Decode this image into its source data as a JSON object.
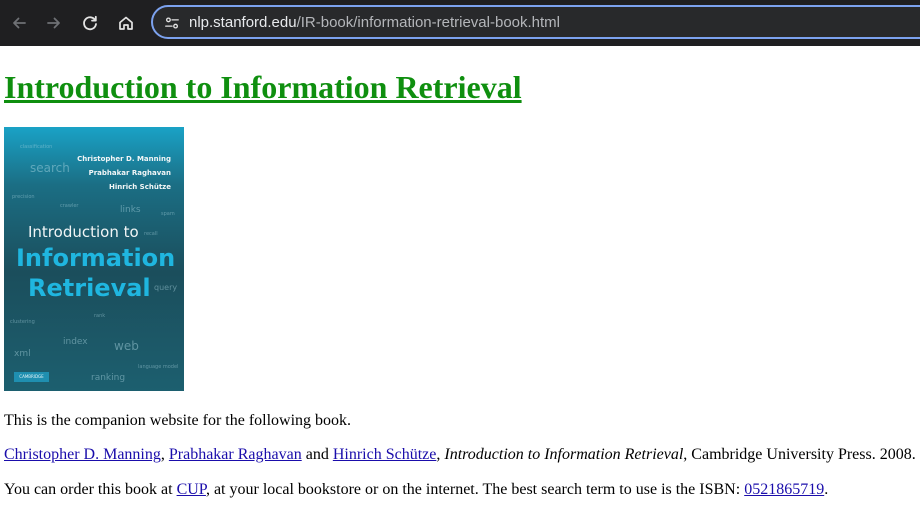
{
  "browser": {
    "url_host": "nlp.stanford.edu",
    "url_path": "/IR-book/information-retrieval-book.html"
  },
  "page": {
    "heading": "Introduction to Information Retrieval",
    "cover": {
      "authors": [
        "Christopher D. Manning",
        "Prabhakar Raghavan",
        "Hinrich Schütze"
      ],
      "title_line1": "Introduction to",
      "title_line2": "Information",
      "title_line3": "Retrieval",
      "publisher": "CAMBRIDGE",
      "words": [
        "classification",
        "search",
        "precision",
        "crawler",
        "links",
        "spam",
        "recall",
        "query",
        "clustering",
        "rank",
        "index",
        "web",
        "xml",
        "language model",
        "ranking"
      ]
    },
    "intro_text": "This is the companion website for the following book.",
    "citation": {
      "author1": "Christopher D. Manning",
      "sep1": ", ",
      "author2": "Prabhakar Raghavan",
      "sep2": " and ",
      "author3": "Hinrich Schütze",
      "sep3": ", ",
      "title": "Introduction to Information Retrieval",
      "rest": ", Cambridge University Press. 2008."
    },
    "order": {
      "before": "You can order this book at ",
      "cup_link": "CUP",
      "middle": ", at your local bookstore or on the internet. The best search term to use is the ISBN: ",
      "isbn_link": "0521865719",
      "after": "."
    }
  }
}
